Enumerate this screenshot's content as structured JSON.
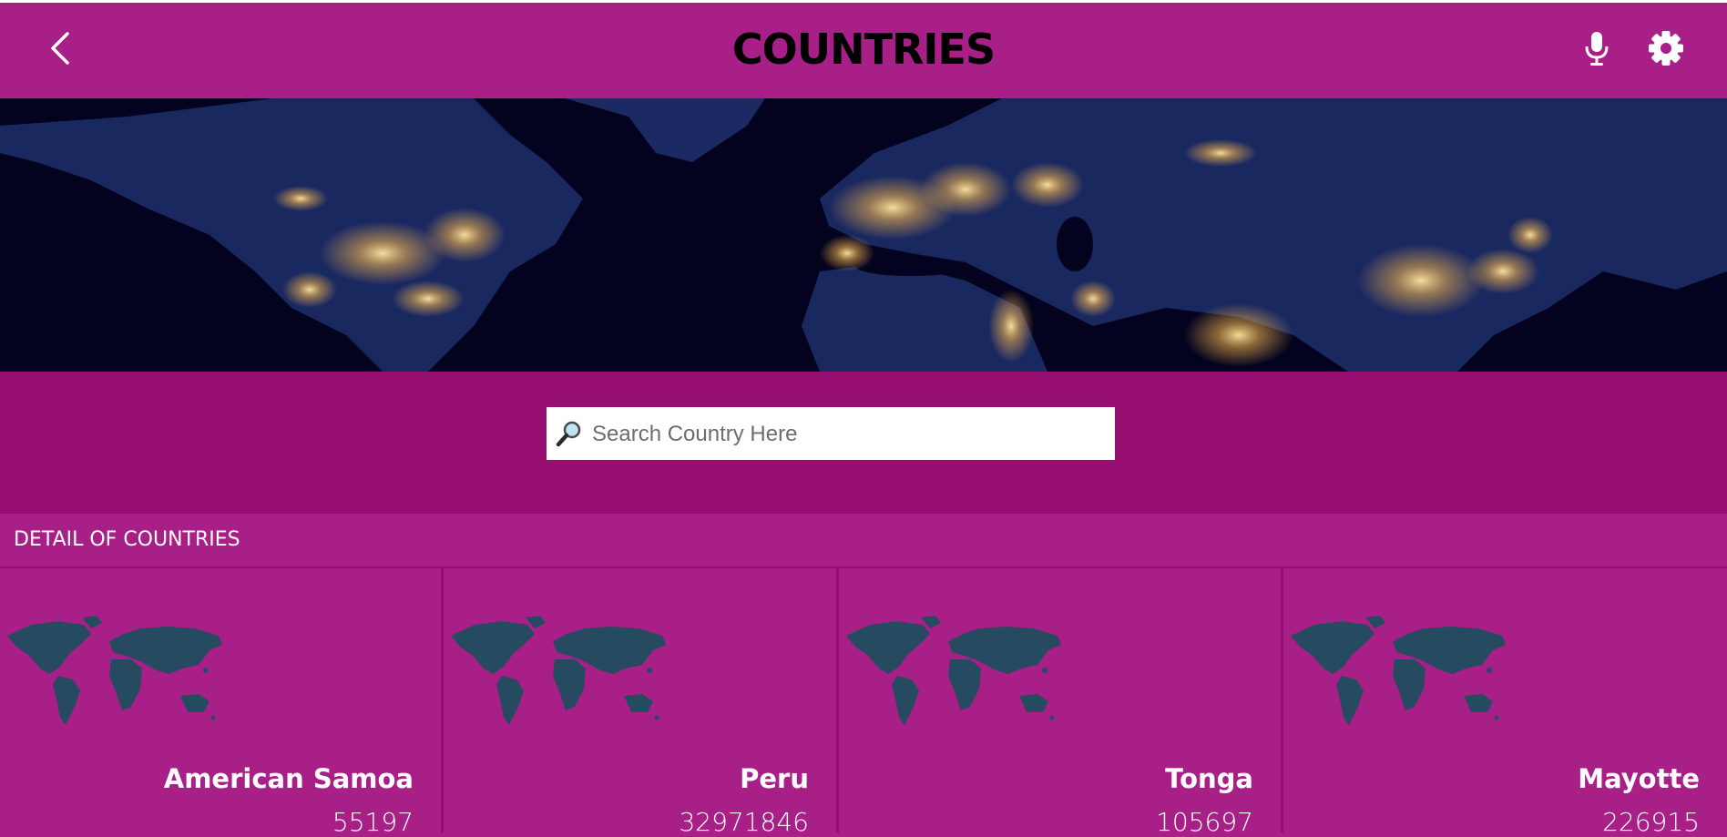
{
  "header": {
    "title": "COUNTRIES",
    "back_icon": "chevron-left-icon",
    "mic_icon": "microphone-icon",
    "settings_icon": "gear-icon"
  },
  "banner": {
    "image": "world-at-night-map"
  },
  "search": {
    "placeholder": "Search Country Here",
    "value": "",
    "icon": "magnifier-icon"
  },
  "section": {
    "title": "DETAIL OF COUNTRIES"
  },
  "countries": [
    {
      "name": "American Samoa",
      "population": "55197",
      "icon": "world-map-icon"
    },
    {
      "name": "Peru",
      "population": "32971846",
      "icon": "world-map-icon"
    },
    {
      "name": "Tonga",
      "population": "105697",
      "icon": "world-map-icon"
    },
    {
      "name": "Mayotte",
      "population": "226915",
      "icon": "world-map-icon"
    }
  ],
  "colors": {
    "primary": "#a91f88",
    "search_band": "#980f72",
    "banner_bg": "#050424",
    "map_fill": "#264a5f",
    "title": "#000000"
  }
}
